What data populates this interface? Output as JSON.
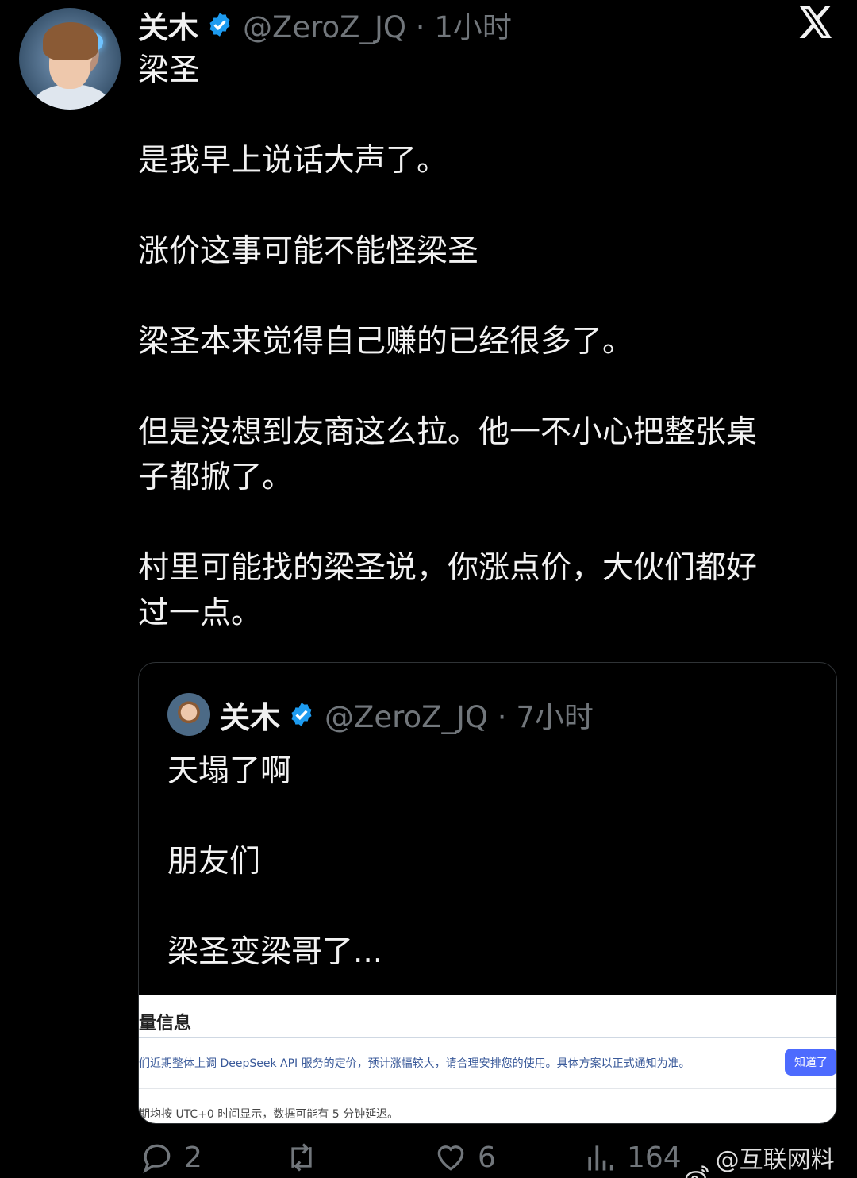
{
  "tweet": {
    "author_name": "关木",
    "handle_time": "@ZeroZ_JQ · 1小时",
    "lines": [
      "梁圣",
      "",
      "是我早上说话大声了。",
      "",
      "涨价这事可能不能怪梁圣",
      "",
      "梁圣本来觉得自己赚的已经很多了。",
      "",
      "但是没想到友商这么拉。他一不小心把整张桌",
      "子都掀了。",
      "",
      "村里可能找的梁圣说，你涨点价，大伙们都好",
      "过一点。"
    ]
  },
  "quote": {
    "author_name": "关木",
    "handle_time": "@ZeroZ_JQ · 7小时",
    "lines": [
      "天塌了啊",
      "",
      "朋友们",
      "",
      "梁圣变梁哥了..."
    ],
    "notice": {
      "title": "量信息",
      "message": "们近期整体上调 DeepSeek API 服务的定价，预计涨幅较大，请合理安排您的使用。具体方案以正式通知为准。",
      "button": "知道了",
      "footer": "期均按 UTC+0 时间显示，数据可能有 5 分钟延迟。"
    }
  },
  "actions": {
    "replies": "2",
    "likes": "6",
    "views": "164"
  },
  "watermark": "@互联网料姐",
  "icons": [
    "verified-badge-icon",
    "x-logo-icon",
    "reply-icon",
    "retweet-icon",
    "like-icon",
    "views-icon",
    "weibo-icon"
  ],
  "colors": {
    "verified": "#1d9bf0",
    "muted": "#71767b",
    "button": "#4d6bfe"
  }
}
